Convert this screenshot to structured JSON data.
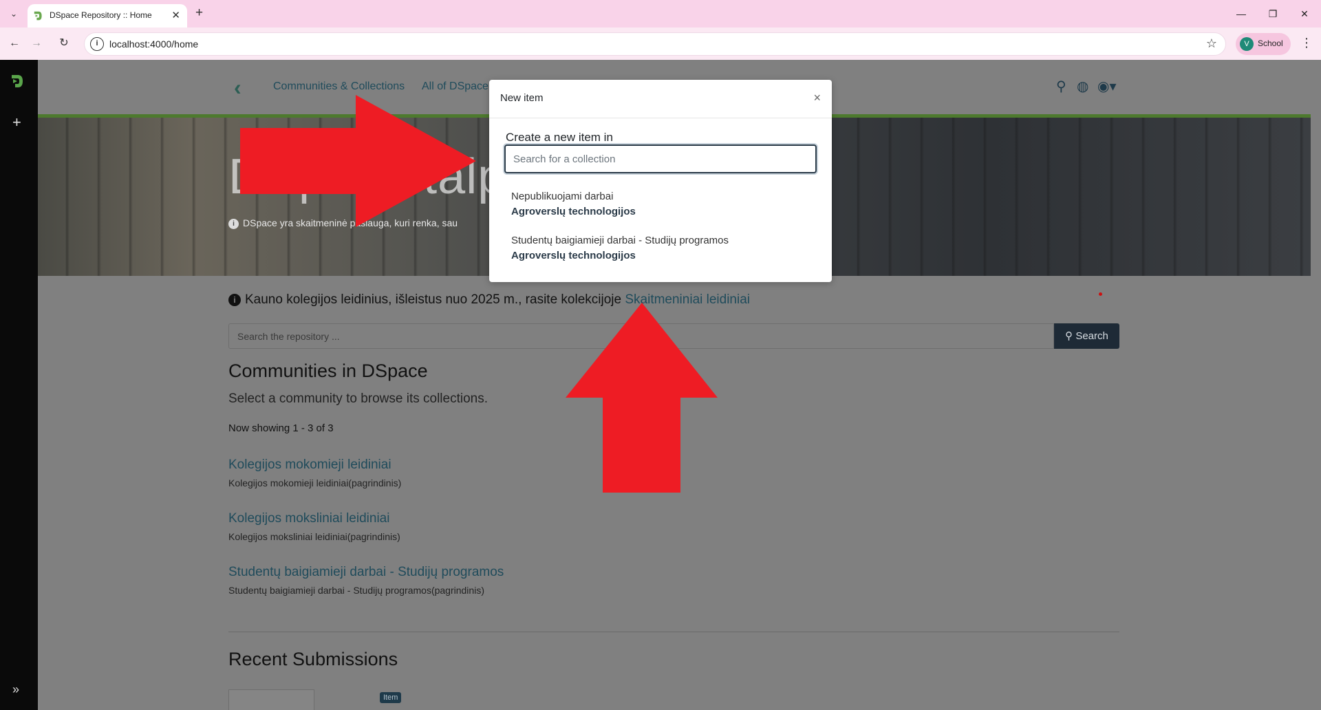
{
  "browser": {
    "tab_title": "DSpace Repository :: Home",
    "url": "localhost:4000/home",
    "profile_initial": "V",
    "profile_name": "School"
  },
  "header": {
    "nav": [
      "Communities & Collections",
      "All of DSpace"
    ]
  },
  "banner": {
    "title": "DSpace talp",
    "subtitle": "DSpace yra skaitmeninė paslauga, kuri renka, sau"
  },
  "notice": {
    "text": "Kauno kolegijos leidinius, išleistus nuo 2025 m., rasite kolekcijoje",
    "link": "Skaitmeniniai leidiniai"
  },
  "search": {
    "placeholder": "Search the repository ...",
    "button": "Search"
  },
  "communities": {
    "heading": "Communities in DSpace",
    "subheading": "Select a community to browse its collections.",
    "showing": "Now showing 1 - 3 of 3",
    "items": [
      {
        "title": "Kolegijos mokomieji leidiniai",
        "desc": "Kolegijos mokomieji leidiniai(pagrindinis)"
      },
      {
        "title": "Kolegijos moksliniai leidiniai",
        "desc": "Kolegijos moksliniai leidiniai(pagrindinis)"
      },
      {
        "title": "Studentų baigiamieji darbai - Studijų programos",
        "desc": "Studentų baigiamieji darbai - Studijų programos(pagrindinis)"
      }
    ]
  },
  "recent": {
    "heading": "Recent Submissions",
    "badge": "Item"
  },
  "modal": {
    "title": "New item",
    "label": "Create a new item in",
    "placeholder": "Search for a collection",
    "collections": [
      {
        "name": "Nepublikuojami darbai",
        "parent": "Agroverslų technologijos"
      },
      {
        "name": "Studentų baigiamieji darbai - Studijų programos",
        "parent": "Agroverslų technologijos"
      }
    ]
  },
  "colors": {
    "arrow": "#ee1c24",
    "accent": "#4d7a2e",
    "dark": "#1e2a36"
  }
}
